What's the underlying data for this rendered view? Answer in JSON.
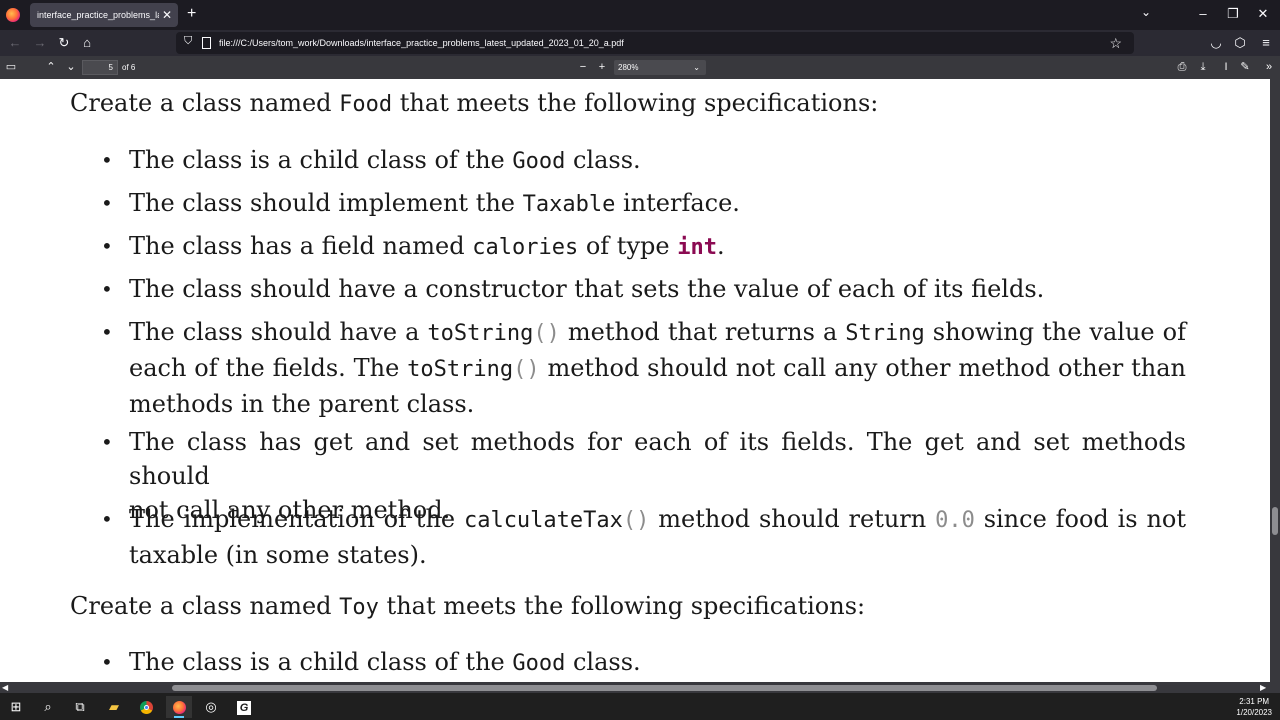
{
  "browser": {
    "tab_title": "interface_practice_problems_latest_updated_2023_01_20_a.pdf",
    "new_tab_icon": "plus-icon",
    "url": "file:///C:/Users/tom_work/Downloads/interface_practice_problems_latest_updated_2023_01_20_a.pdf"
  },
  "pdf_toolbar": {
    "page_number": "5",
    "page_count": "of 6",
    "zoom": "280%"
  },
  "document": {
    "para1": {
      "prefix": "Create a class named ",
      "code": "Food",
      "suffix": " that meets the following specifications:"
    },
    "bullets": [
      {
        "t1": "The class is a child class of the ",
        "c1": "Good",
        "t2": " class."
      },
      {
        "t1": "The class should implement the ",
        "c1": "Taxable",
        "t2": " interface."
      },
      {
        "t1": "The class has a field named ",
        "c1": "calories",
        "t2": " of type ",
        "c2": "int",
        "t3": "."
      },
      {
        "t1": "The class should have a constructor that sets the value of each of its fields."
      },
      {
        "t1": "The class should have a ",
        "c1": "toString",
        "p1": "()",
        "t2": " method that returns a ",
        "c2": "String",
        "t3": " showing the value of",
        "t4": "each of the fields. The ",
        "c3": "toString",
        "p2": "()",
        "t5": " method should not call any other method other than",
        "t6": "methods in the parent class."
      },
      {
        "t1": "The class has get and set methods for each of its fields. The get and set methods should",
        "t2": "not call any other method."
      },
      {
        "t1": "The implementation of the ",
        "c1": "calculateTax",
        "p1": "()",
        "t2": " method should return ",
        "c2": "0.0",
        "t3": " since food is not",
        "t4": "taxable (in some states)."
      }
    ],
    "para2": {
      "prefix": "Create a class named ",
      "code": "Toy",
      "suffix": " that meets the following specifications:"
    },
    "bullet_last": {
      "t1": "The class is a child class of the ",
      "c1": "Good",
      "t2": " class."
    }
  },
  "taskbar": {
    "time": "2:31 PM",
    "date": "1/20/2023"
  },
  "colors": {
    "keyword": "#8b0a52",
    "literal": "#8c8c8c"
  }
}
